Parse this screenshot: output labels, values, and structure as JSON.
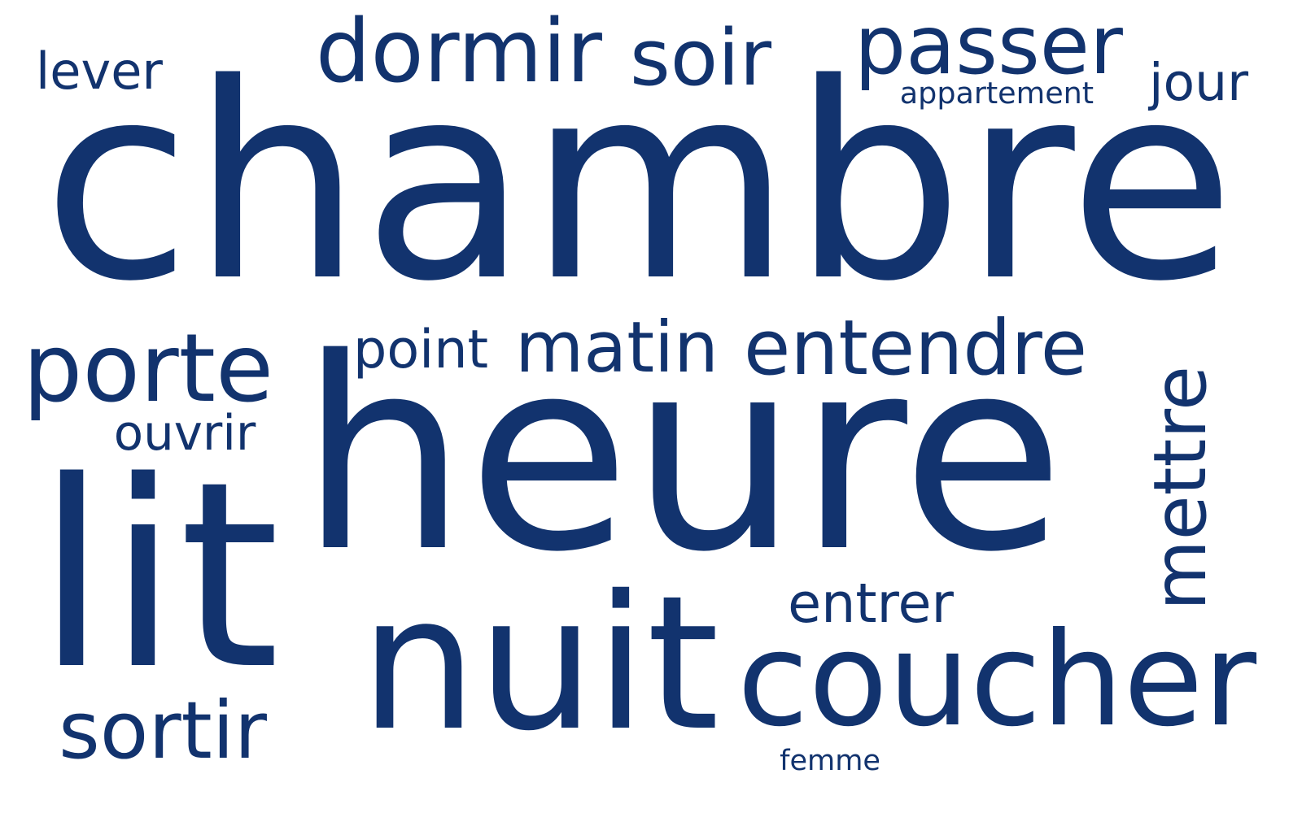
{
  "cloud": {
    "color": "#12336e",
    "words": {
      "chambre": "chambre",
      "heure": "heure",
      "lit": "lit",
      "nuit": "nuit",
      "coucher": "coucher",
      "mettre": "mettre",
      "passer": "passer",
      "dormir": "dormir",
      "soir": "soir",
      "porte": "porte",
      "matin": "matin",
      "entendre": "entendre",
      "point": "point",
      "sortir": "sortir",
      "entrer": "entrer",
      "ouvrir": "ouvrir",
      "jour": "jour",
      "lever": "lever",
      "appartement": "appartement",
      "femme": "femme"
    }
  }
}
